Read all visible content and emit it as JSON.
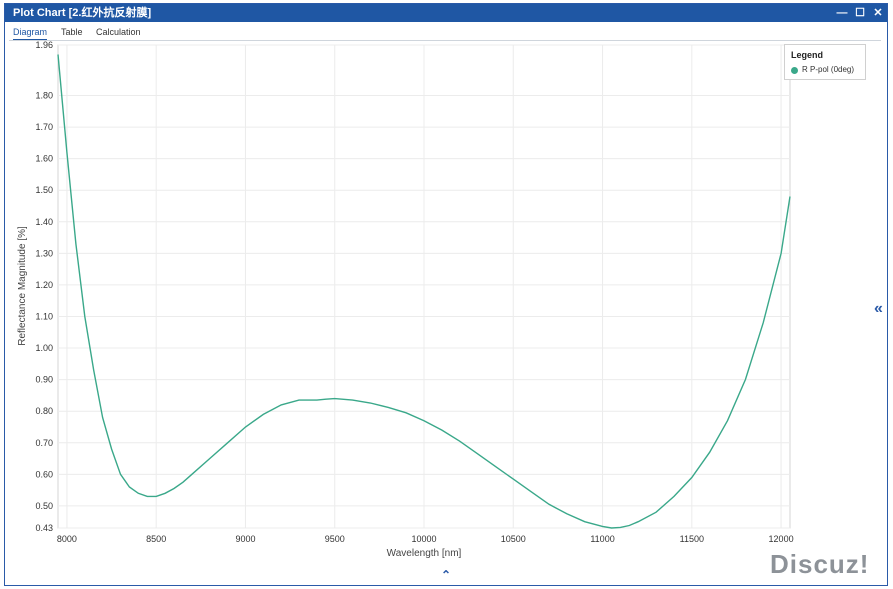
{
  "window": {
    "title": "Plot Chart [2.红外抗反射膜]",
    "controls": [
      "—",
      "☐",
      "✕"
    ]
  },
  "tabs": [
    {
      "label": "Diagram",
      "active": true
    },
    {
      "label": "Table",
      "active": false
    },
    {
      "label": "Calculation",
      "active": false
    }
  ],
  "legend": {
    "title": "Legend",
    "entries": [
      {
        "label": "R P-pol (0deg)",
        "color": "#3aa88a"
      }
    ]
  },
  "side_toggle": "«",
  "bottom_toggle": "⌃",
  "watermark": "Discuz!",
  "chart_data": {
    "type": "line",
    "title": "",
    "xlabel": "Wavelength [nm]",
    "ylabel": "Reflectance Magnitude [%]",
    "xlim": [
      7950,
      12050
    ],
    "ylim": [
      0.43,
      1.96
    ],
    "xticks": [
      8000,
      8500,
      9000,
      9500,
      10000,
      10500,
      11000,
      11500,
      12000
    ],
    "yticks": [
      0.43,
      0.5,
      0.6,
      0.7,
      0.8,
      0.9,
      1.0,
      1.1,
      1.2,
      1.3,
      1.4,
      1.5,
      1.6,
      1.7,
      1.8,
      1.96
    ],
    "ytick_labels": [
      "0.43",
      "0.50",
      "0.60",
      "0.70",
      "0.80",
      "0.90",
      "1.00",
      "1.10",
      "1.20",
      "1.30",
      "1.40",
      "1.50",
      "1.60",
      "1.70",
      "1.80",
      "1.96"
    ],
    "grid": true,
    "legend_position": "top-right",
    "series": [
      {
        "name": "R P-pol (0deg)",
        "color": "#3aa88a",
        "x": [
          7950,
          8000,
          8050,
          8100,
          8150,
          8200,
          8250,
          8300,
          8350,
          8400,
          8450,
          8500,
          8550,
          8600,
          8650,
          8700,
          8800,
          8900,
          9000,
          9100,
          9200,
          9300,
          9350,
          9400,
          9450,
          9500,
          9600,
          9700,
          9800,
          9900,
          10000,
          10100,
          10200,
          10300,
          10400,
          10500,
          10600,
          10700,
          10800,
          10900,
          11000,
          11050,
          11100,
          11150,
          11200,
          11300,
          11400,
          11500,
          11600,
          11700,
          11800,
          11900,
          12000,
          12050
        ],
        "y": [
          1.93,
          1.62,
          1.33,
          1.1,
          0.93,
          0.78,
          0.68,
          0.6,
          0.56,
          0.54,
          0.53,
          0.53,
          0.54,
          0.555,
          0.575,
          0.6,
          0.65,
          0.7,
          0.75,
          0.79,
          0.82,
          0.835,
          0.835,
          0.835,
          0.838,
          0.84,
          0.835,
          0.826,
          0.812,
          0.795,
          0.77,
          0.74,
          0.705,
          0.665,
          0.625,
          0.585,
          0.545,
          0.505,
          0.475,
          0.45,
          0.435,
          0.43,
          0.432,
          0.438,
          0.45,
          0.48,
          0.53,
          0.59,
          0.67,
          0.77,
          0.9,
          1.08,
          1.3,
          1.48
        ]
      }
    ]
  }
}
